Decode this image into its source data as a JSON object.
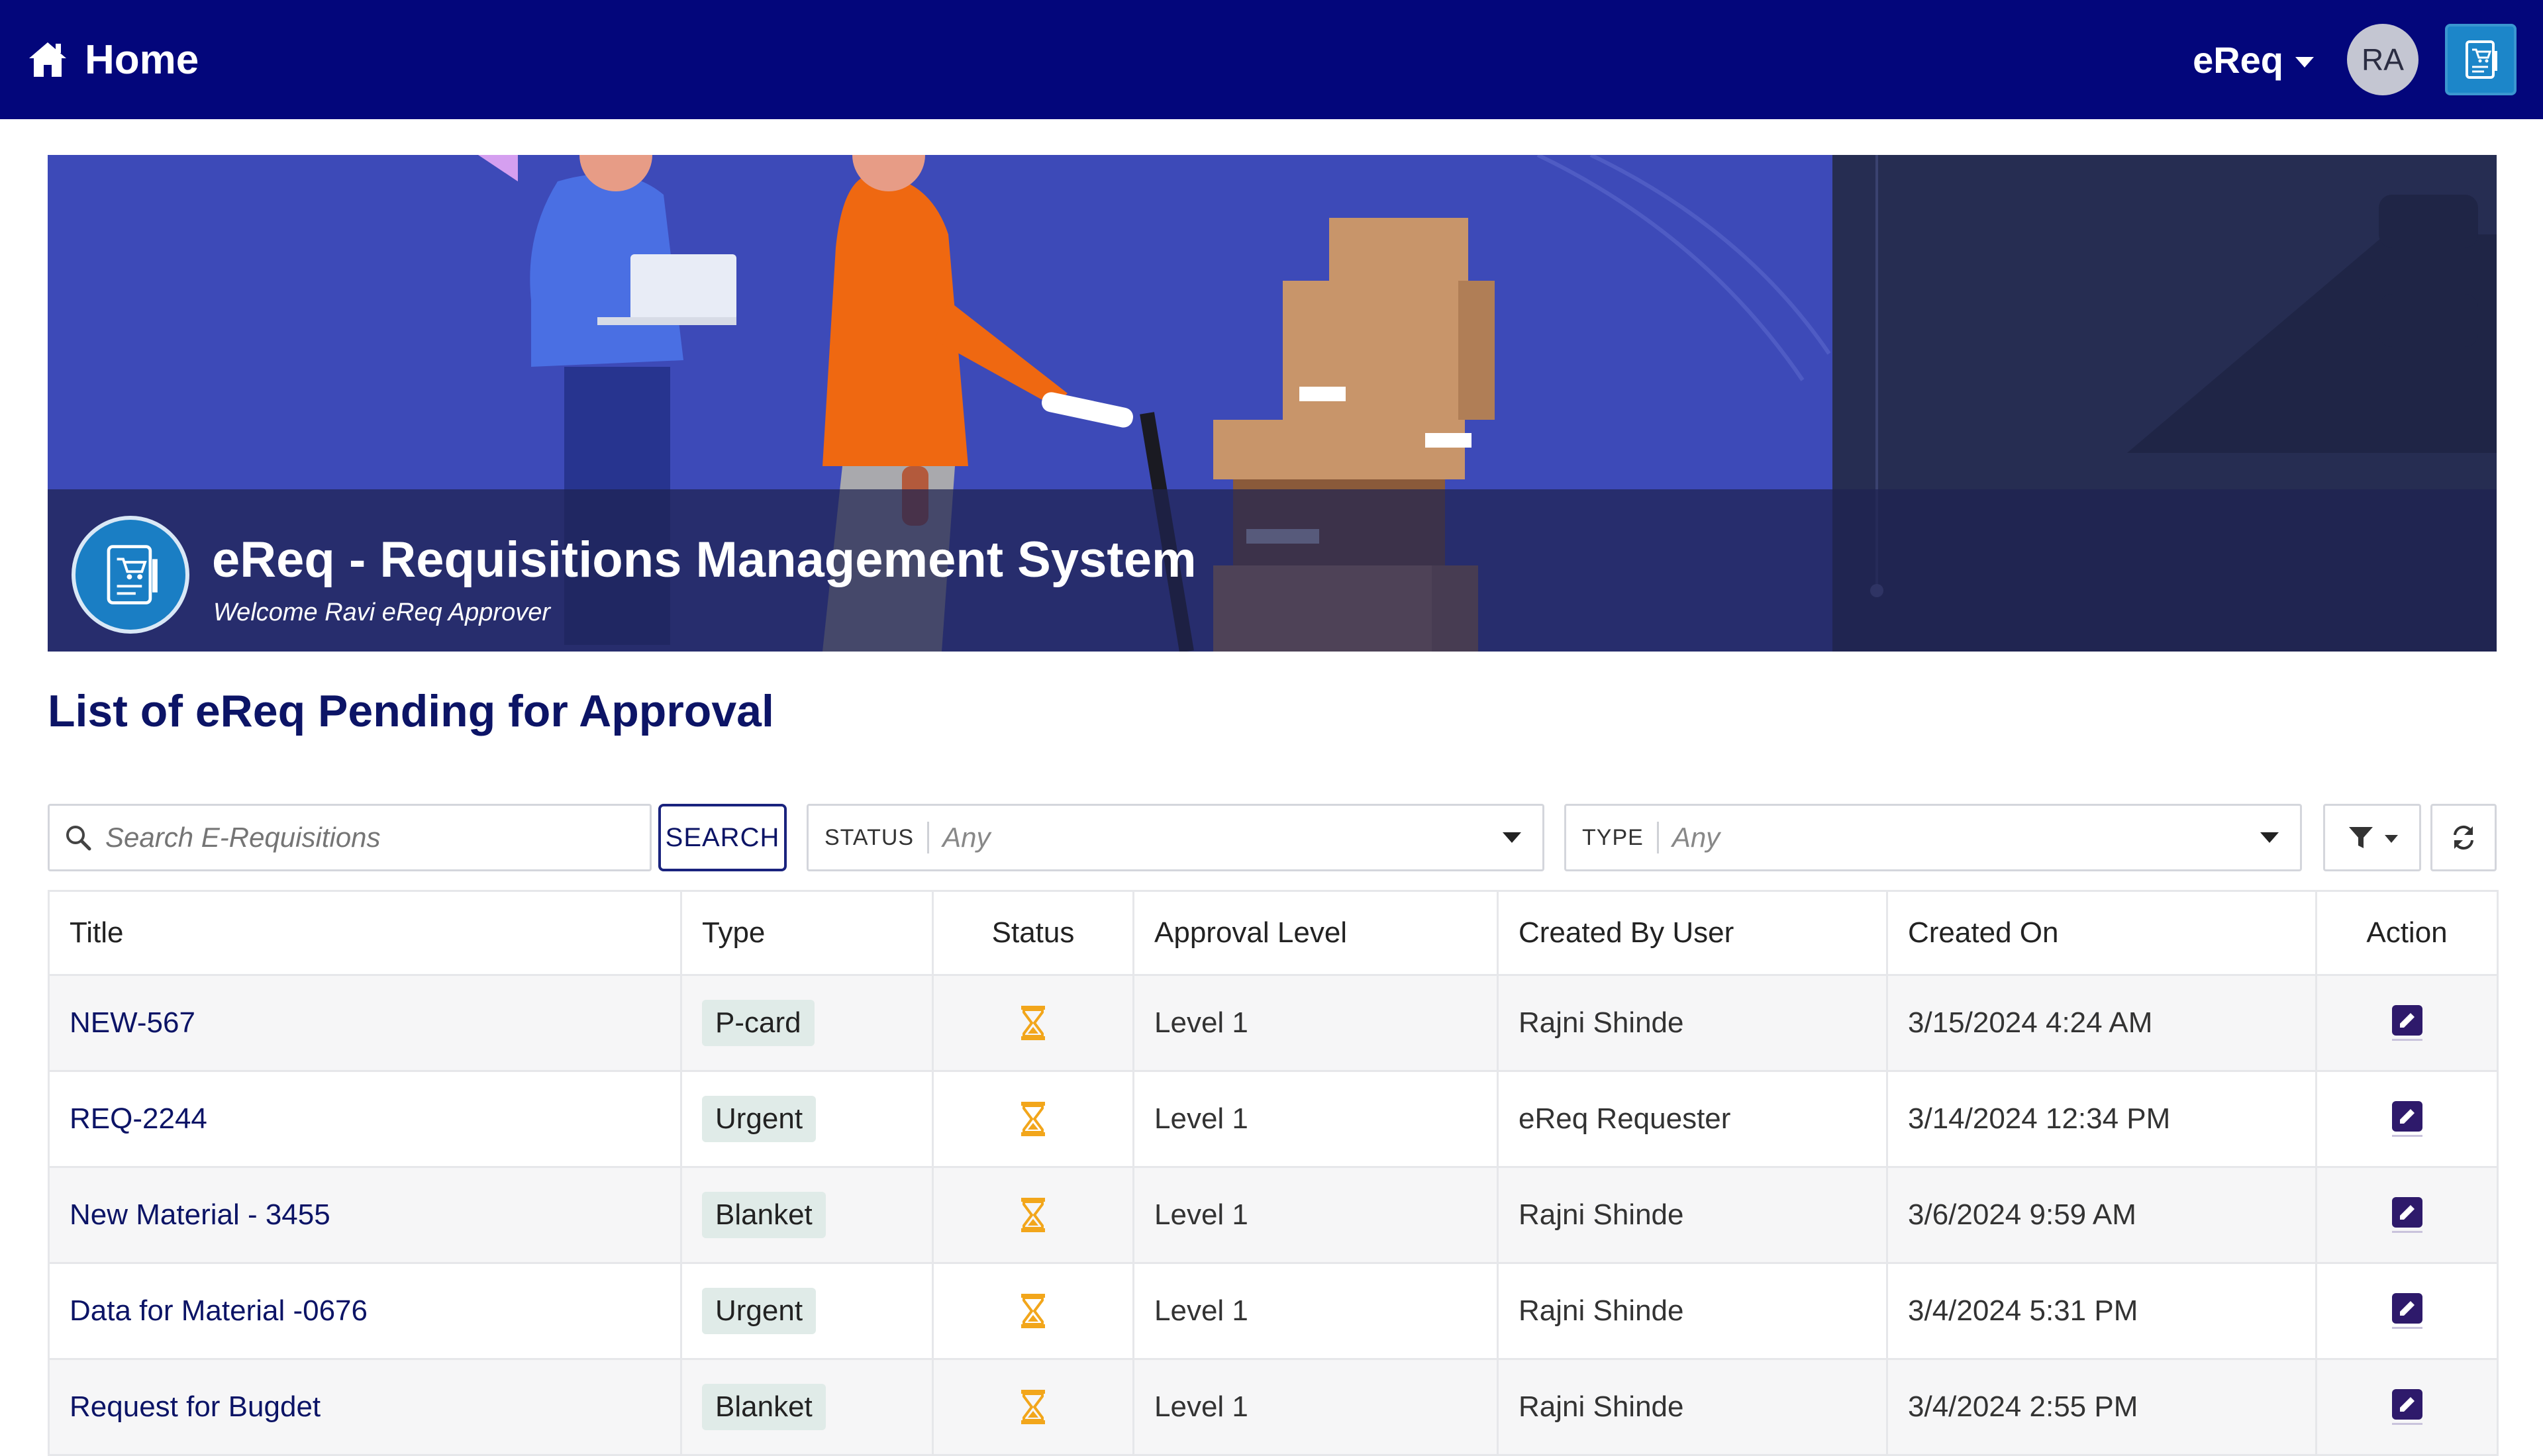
{
  "nav": {
    "home_label": "Home",
    "app_menu_label": "eReq",
    "avatar_initials": "RA",
    "bar_color": "#03067b"
  },
  "hero": {
    "title": "eReq - Requisitions Management System",
    "subtitle": "Welcome Ravi eReq  Approver"
  },
  "section_title": "List of eReq Pending for Approval",
  "toolbar": {
    "search_placeholder": "Search E-Requisitions",
    "search_button": "SEARCH",
    "status_label": "STATUS",
    "status_value": "Any",
    "type_label": "TYPE",
    "type_value": "Any",
    "filter_icon": "filter-icon",
    "refresh_icon": "refresh-icon"
  },
  "table": {
    "columns": [
      "Title",
      "Type",
      "Status",
      "Approval Level",
      "Created By User",
      "Created On",
      "Action"
    ],
    "rows": [
      {
        "title": "NEW-567",
        "type": "P-card",
        "status_icon": "hourglass-icon",
        "level": "Level 1",
        "created_by": "Rajni Shinde",
        "created_on": "3/15/2024 4:24 AM",
        "action_icon": "edit-icon"
      },
      {
        "title": "REQ-2244",
        "type": "Urgent",
        "status_icon": "hourglass-icon",
        "level": "Level 1",
        "created_by": "eReq Requester",
        "created_on": "3/14/2024 12:34 PM",
        "action_icon": "edit-icon"
      },
      {
        "title": "New Material - 3455",
        "type": "Blanket",
        "status_icon": "hourglass-icon",
        "level": "Level 1",
        "created_by": "Rajni Shinde",
        "created_on": "3/6/2024 9:59 AM",
        "action_icon": "edit-icon"
      },
      {
        "title": "Data for Material -0676",
        "type": "Urgent",
        "status_icon": "hourglass-icon",
        "level": "Level 1",
        "created_by": "Rajni Shinde",
        "created_on": "3/4/2024 5:31 PM",
        "action_icon": "edit-icon"
      },
      {
        "title": "Request for Bugdet",
        "type": "Blanket",
        "status_icon": "hourglass-icon",
        "level": "Level 1",
        "created_by": "Rajni Shinde",
        "created_on": "3/4/2024 2:55 PM",
        "action_icon": "edit-icon"
      }
    ]
  },
  "colors": {
    "heading": "#0c1466",
    "hourglass": "#f2a61b",
    "edit_icon": "#2e1a6b",
    "badge_bg": "#e0ebe8"
  }
}
